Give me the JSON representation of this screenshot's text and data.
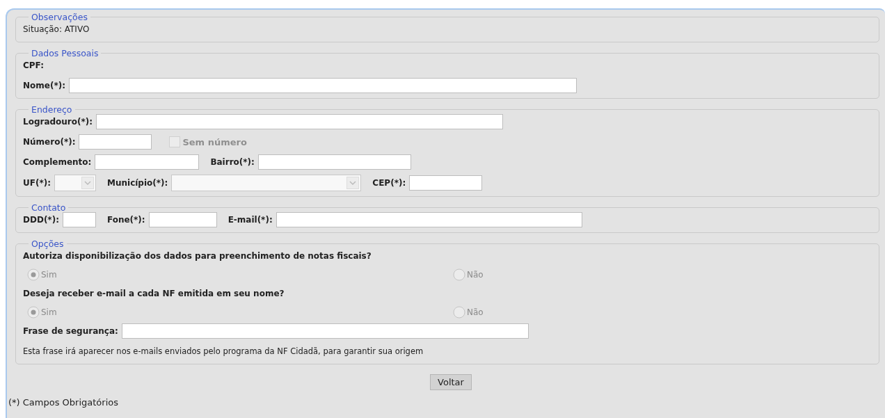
{
  "sections": [
    {
      "legend": "Observações",
      "rows": [
        [
          {
            "kind": "text",
            "text": "Situação: ATIVO"
          }
        ]
      ]
    },
    {
      "legend": "Dados Pessoais",
      "rows": [
        [
          {
            "kind": "label",
            "text": "CPF:"
          }
        ],
        [
          {
            "kind": "label",
            "text": "Nome(*):"
          },
          {
            "kind": "input"
          }
        ]
      ]
    },
    {
      "legend": "Endereço",
      "rows": [
        [
          {
            "kind": "label",
            "text": "Logradouro(*):"
          },
          {
            "kind": "input"
          }
        ],
        [
          {
            "kind": "label",
            "text": "Número(*):"
          },
          {
            "kind": "input"
          },
          {
            "kind": "checkbox",
            "label": "Sem número",
            "checked": false,
            "disabled": true
          }
        ],
        [
          {
            "kind": "label",
            "text": "Complemento:"
          },
          {
            "kind": "input"
          },
          {
            "kind": "label",
            "text": "Bairro(*):"
          },
          {
            "kind": "input"
          }
        ],
        [
          {
            "kind": "label",
            "text": "UF(*):"
          },
          {
            "kind": "select",
            "disabled": true
          },
          {
            "kind": "label",
            "text": "Município(*):"
          },
          {
            "kind": "select",
            "disabled": true
          },
          {
            "kind": "label",
            "text": "CEP(*):"
          },
          {
            "kind": "input"
          }
        ]
      ]
    },
    {
      "legend": "Contato",
      "rows": [
        [
          {
            "kind": "label",
            "text": "DDD(*):"
          },
          {
            "kind": "input"
          },
          {
            "kind": "label",
            "text": "Fone(*):"
          },
          {
            "kind": "input"
          },
          {
            "kind": "label",
            "text": "E-mail(*):"
          },
          {
            "kind": "input"
          }
        ]
      ]
    },
    {
      "legend": "Opções",
      "rows": [
        [
          {
            "kind": "label",
            "text": "Autoriza disponibilização dos dados para preenchimento de notas fiscais?"
          }
        ],
        [
          {
            "kind": "radio",
            "label": "Sim",
            "selected": true,
            "disabled": true
          },
          {
            "kind": "radio",
            "label": "Não",
            "selected": false,
            "disabled": true
          }
        ],
        [
          {
            "kind": "label",
            "text": "Deseja receber e-mail a cada NF emitida em seu nome?"
          }
        ],
        [
          {
            "kind": "radio",
            "label": "Sim",
            "selected": true,
            "disabled": true
          },
          {
            "kind": "radio",
            "label": "Não",
            "selected": false,
            "disabled": true
          }
        ],
        [
          {
            "kind": "label",
            "text": "Frase de segurança:"
          },
          {
            "kind": "input"
          }
        ],
        [
          {
            "kind": "text",
            "text": "Esta frase irá aparecer nos e-mails enviados pelo programa da NF Cidadã, para garantir sua origem"
          }
        ]
      ]
    }
  ],
  "button": "Voltar",
  "footnote": "(*) Campos Obrigatórios"
}
